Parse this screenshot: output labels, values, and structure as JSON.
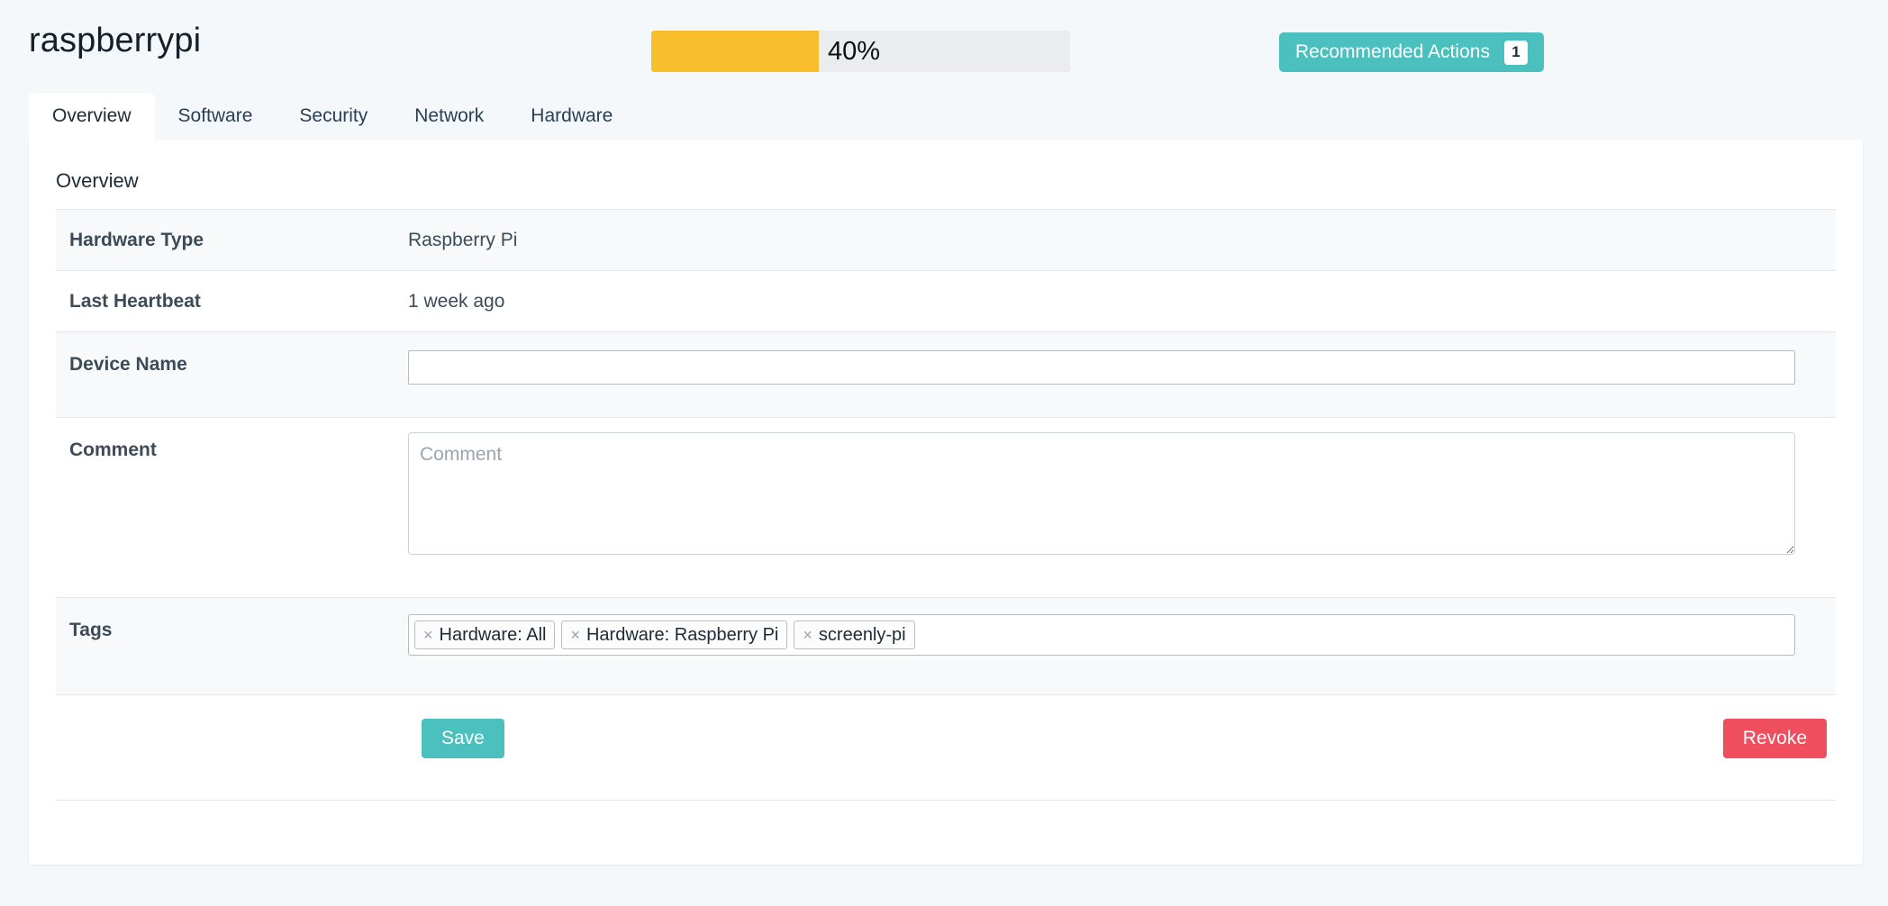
{
  "header": {
    "device_title": "raspberrypi",
    "progress": {
      "percent_label": "40%",
      "value": 40,
      "fill_color": "#f8be2c",
      "track_color": "#eaecee"
    },
    "recommended_actions": {
      "label": "Recommended Actions",
      "badge_count": "1",
      "color": "#4cbfbf"
    }
  },
  "tabs": [
    {
      "label": "Overview",
      "active": true
    },
    {
      "label": "Software",
      "active": false
    },
    {
      "label": "Security",
      "active": false
    },
    {
      "label": "Network",
      "active": false
    },
    {
      "label": "Hardware",
      "active": false
    }
  ],
  "panel": {
    "heading": "Overview",
    "rows": {
      "hardware_type": {
        "label": "Hardware Type",
        "value": "Raspberry Pi"
      },
      "last_heartbeat": {
        "label": "Last Heartbeat",
        "value": "1 week ago"
      },
      "device_name": {
        "label": "Device Name",
        "value": "",
        "placeholder": ""
      },
      "comment": {
        "label": "Comment",
        "value": "",
        "placeholder": "Comment"
      },
      "tags": {
        "label": "Tags",
        "chips": [
          {
            "remove_icon": "×",
            "text": "Hardware: All"
          },
          {
            "remove_icon": "×",
            "text": "Hardware: Raspberry Pi"
          },
          {
            "remove_icon": "×",
            "text": "screenly-pi"
          }
        ]
      }
    },
    "actions": {
      "save_label": "Save",
      "save_color": "#4cbfbf",
      "revoke_label": "Revoke",
      "revoke_color": "#ef4e5e"
    }
  }
}
